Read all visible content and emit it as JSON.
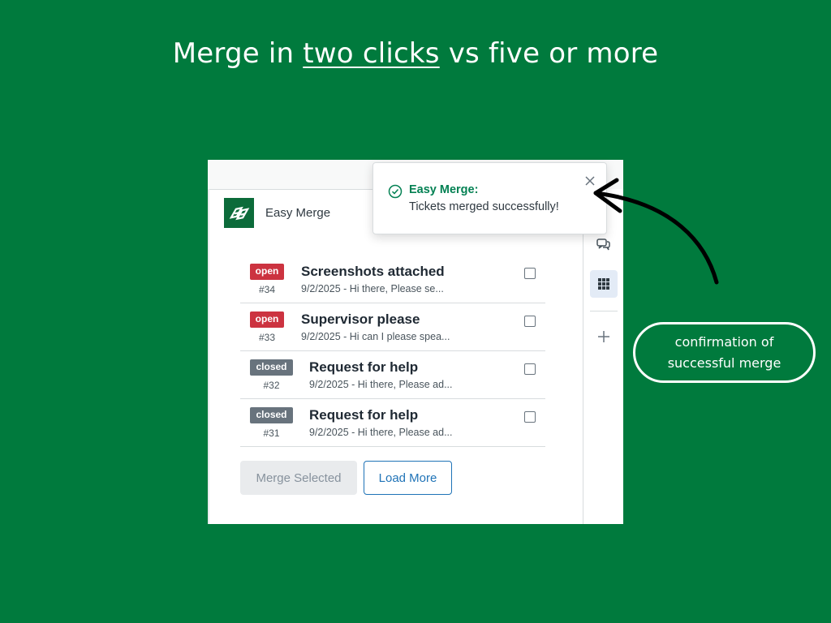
{
  "headline": {
    "prefix": "Merge in ",
    "emphasis": "two clicks",
    "suffix": " vs five or more"
  },
  "app": {
    "name": "Easy Merge",
    "logo_icon": "merge-logo-icon",
    "brand_color": "#0c6b3a"
  },
  "tickets": [
    {
      "status": "open",
      "id": "#34",
      "title": "Screenshots attached",
      "preview": "9/2/2025 - Hi there, Please se..."
    },
    {
      "status": "open",
      "id": "#33",
      "title": "Supervisor please",
      "preview": "9/2/2025 - Hi can I please spea..."
    },
    {
      "status": "closed",
      "id": "#32",
      "title": "Request for help",
      "preview": "9/2/2025 - Hi there, Please ad..."
    },
    {
      "status": "closed",
      "id": "#31",
      "title": "Request for help",
      "preview": "9/2/2025 - Hi there, Please ad..."
    }
  ],
  "buttons": {
    "merge": "Merge Selected",
    "load_more": "Load More"
  },
  "toast": {
    "title": "Easy Merge:",
    "message": "Tickets merged successfully!",
    "icon": "check-circle-icon"
  },
  "rail": {
    "icons": [
      "chat-bubbles-icon",
      "apps-grid-icon",
      "plus-icon"
    ]
  },
  "callout": {
    "text": "confirmation of successful merge"
  },
  "colors": {
    "background": "#007a3d",
    "open": "#cc3340",
    "closed": "#68737d",
    "link": "#1f73b7",
    "success": "#038153"
  }
}
